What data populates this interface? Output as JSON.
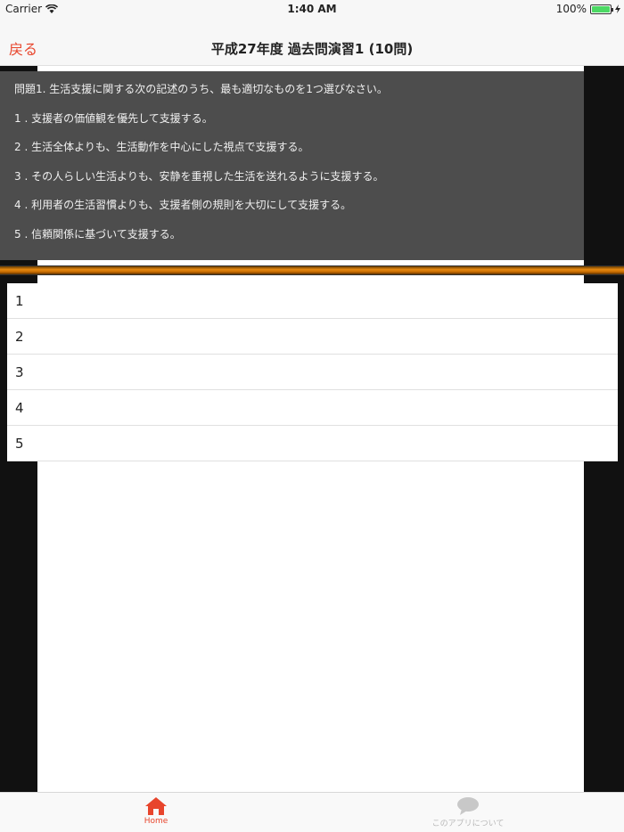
{
  "status_bar": {
    "carrier": "Carrier",
    "time": "1:40 AM",
    "battery": "100%",
    "battery_level": 100
  },
  "nav": {
    "back_label": "戻る",
    "title": "平成27年度 過去問演習1 (10問)"
  },
  "question": {
    "prompt": "問題1. 生活支援に関する次の記述のうち、最も適切なものを1つ選びなさい。",
    "choices": [
      "1 . 支援者の価値観を優先して支援する。",
      "2 . 生活全体よりも、生活動作を中心にした視点で支援する。",
      "3 . その人らしい生活よりも、安静を重視した生活を送れるように支援する。",
      "4 . 利用者の生活習慣よりも、支援者側の規則を大切にして支援する。",
      "5 . 信頼関係に基づいて支援する。"
    ]
  },
  "answers": [
    "1",
    "2",
    "3",
    "4",
    "5"
  ],
  "tabs": {
    "home_label": "Home",
    "about_label": "このアプリについて"
  },
  "colors": {
    "accent": "#e8452c",
    "question_bg": "#4d4d4d",
    "side_bg": "#111111",
    "divider_orange": "#e88a10"
  },
  "icons": {
    "home": "home-icon",
    "about": "speech-bubble-icon",
    "wifi": "wifi-icon",
    "charging": "bolt-icon"
  }
}
